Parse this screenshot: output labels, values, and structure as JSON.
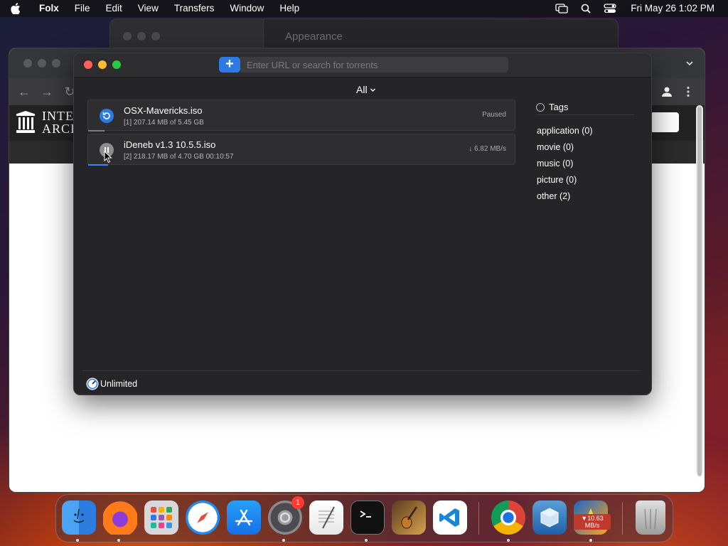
{
  "menubar": {
    "app_name": "Folx",
    "menus": [
      "File",
      "Edit",
      "View",
      "Transfers",
      "Window",
      "Help"
    ],
    "clock": "Fri May 26  1:02 PM"
  },
  "background_window": {
    "title": "Appearance"
  },
  "browser": {
    "ia_logo_text_line1": "INTE",
    "ia_logo_text_line2": "ARCH"
  },
  "folx": {
    "url_placeholder": "Enter URL or search for torrents",
    "add_label": "+",
    "filter_label": "All",
    "torrents": [
      {
        "name": "OSX-Mavericks.iso",
        "meta": "[1] 207.14 MB of 5.45 GB",
        "status": "Paused",
        "progress": 0.038
      },
      {
        "name": "iDeneb v1.3 10.5.5.iso",
        "meta": "[2] 218.17 MB of 4.70 GB  00:10:57",
        "status": "↓ 6.82 MB/s",
        "progress": 0.046
      }
    ],
    "tags_header": "Tags",
    "tags": [
      "application (0)",
      "movie (0)",
      "music (0)",
      "picture (0)",
      "other (2)"
    ],
    "speed_limit": "Unlimited"
  },
  "dock": {
    "items": [
      "finder-icon",
      "firefox-icon",
      "launchpad-icon",
      "safari-icon",
      "app-store-icon",
      "system-settings-icon",
      "textedit-icon",
      "terminal-icon",
      "garageband-icon",
      "vscode-icon",
      "chrome-icon",
      "virtualbox-icon",
      "folx-icon",
      "trash-icon"
    ],
    "settings_badge": "1",
    "folx_speed": "▼10.63 MB/s"
  },
  "colors": {
    "accent": "#2c7be5",
    "window_bg": "#252527",
    "close": "#fe5f57",
    "minimize": "#febc2e",
    "maximize": "#28c840"
  }
}
